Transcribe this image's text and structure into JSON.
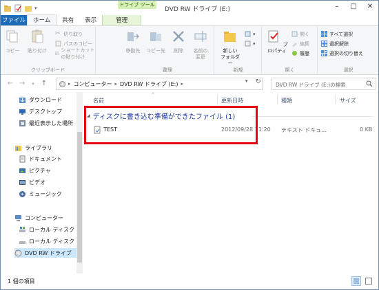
{
  "window": {
    "title": "DVD RW ドライブ (E:)",
    "context_tab_group": "ドライブ ツール"
  },
  "tabs": [
    "ファイル",
    "ホーム",
    "共有",
    "表示",
    "管理"
  ],
  "ribbon": {
    "clipboard": {
      "copy": "コピー",
      "paste": "貼り付け",
      "cut": "切り取り",
      "copy_path": "パスのコピー",
      "paste_shortcut": "ショートカットの貼り付け",
      "label": "クリップボード"
    },
    "organize": {
      "move_to": "移動先",
      "copy_to": "コピー先",
      "delete": "削除",
      "rename_line1": "名前の",
      "rename_line2": "変更",
      "label": "整理"
    },
    "new": {
      "new_folder_line1": "新しい",
      "new_folder_line2": "フォルダー",
      "label": "新規"
    },
    "open": {
      "properties": "プロパティ",
      "open": "開く",
      "edit": "編集",
      "history": "履歴",
      "label": "開く"
    },
    "select": {
      "select_all": "すべて選択",
      "select_none": "選択解除",
      "invert": "選択の切り替え",
      "label": "選択"
    }
  },
  "address": {
    "segments": [
      "コンピューター",
      "DVD RW ドライブ (E:)"
    ],
    "search_placeholder": "DVD RW ドライブ (E:)の検索"
  },
  "nav": {
    "items": [
      {
        "label": "ダウンロード",
        "icon": "download-folder-icon"
      },
      {
        "label": "デスクトップ",
        "icon": "desktop-icon"
      },
      {
        "label": "最近表示した場所",
        "icon": "recent-places-icon"
      },
      {
        "label": "ライブラリ",
        "icon": "library-icon"
      },
      {
        "label": "ドキュメント",
        "icon": "documents-icon"
      },
      {
        "label": "ピクチャ",
        "icon": "pictures-icon"
      },
      {
        "label": "ビデオ",
        "icon": "videos-icon"
      },
      {
        "label": "ミュージック",
        "icon": "music-icon"
      },
      {
        "label": "コンピューター",
        "icon": "computer-icon"
      },
      {
        "label": "ローカル ディスク",
        "icon": "local-disk-icon"
      },
      {
        "label": "ローカル ディスク",
        "icon": "local-disk-icon"
      },
      {
        "label": "DVD RW ドライブ",
        "icon": "dvd-drive-icon"
      }
    ]
  },
  "columns": [
    "名前",
    "更新日時",
    "種類",
    "サイズ"
  ],
  "group": {
    "title": "ディスクに書き込む準備ができたファイル (1)"
  },
  "files": [
    {
      "name": "TEST",
      "modified": "2012/09/28 11:20",
      "type": "テキスト ドキュ...",
      "size": "0 KB"
    }
  ],
  "status": {
    "count": "1 個の項目"
  },
  "colors": {
    "accent": "#1e6bb8",
    "highlight": "#e60012",
    "group_header": "#1e3aa8",
    "context_tab": "#d6f0b6"
  }
}
